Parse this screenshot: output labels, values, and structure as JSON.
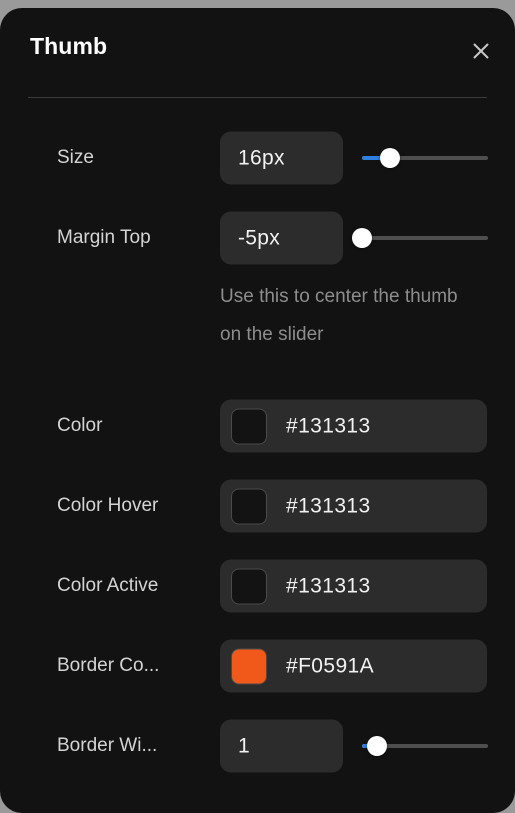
{
  "panel": {
    "title": "Thumb",
    "close_icon": "close-icon",
    "accent_blue": "#2F7FE0",
    "background": "#121212",
    "field_background": "#2C2C2C"
  },
  "rows": [
    {
      "id": "size",
      "label": "Size",
      "type": "number-slider",
      "value": "16px",
      "slider": {
        "percent": 22,
        "filled": true
      }
    },
    {
      "id": "margin-top",
      "label": "Margin Top",
      "type": "number-slider",
      "value": "-5px",
      "slider": {
        "percent": 0,
        "filled": false
      }
    },
    {
      "id": "margin-top-hint",
      "type": "hint",
      "text": "Use this to center the thumb on the slider"
    },
    {
      "id": "color",
      "label": "Color",
      "type": "color",
      "value": "#131313",
      "swatch": "#131313"
    },
    {
      "id": "color-hover",
      "label": "Color Hover",
      "type": "color",
      "value": "#131313",
      "swatch": "#131313"
    },
    {
      "id": "color-active",
      "label": "Color Active",
      "type": "color",
      "value": "#131313",
      "swatch": "#131313"
    },
    {
      "id": "border-color",
      "label": "Border Co...",
      "type": "color",
      "value": "#F0591A",
      "swatch": "#F0591A"
    },
    {
      "id": "border-width",
      "label": "Border Wi...",
      "type": "number-slider",
      "value": "1",
      "slider": {
        "percent": 12,
        "filled": true
      }
    }
  ]
}
